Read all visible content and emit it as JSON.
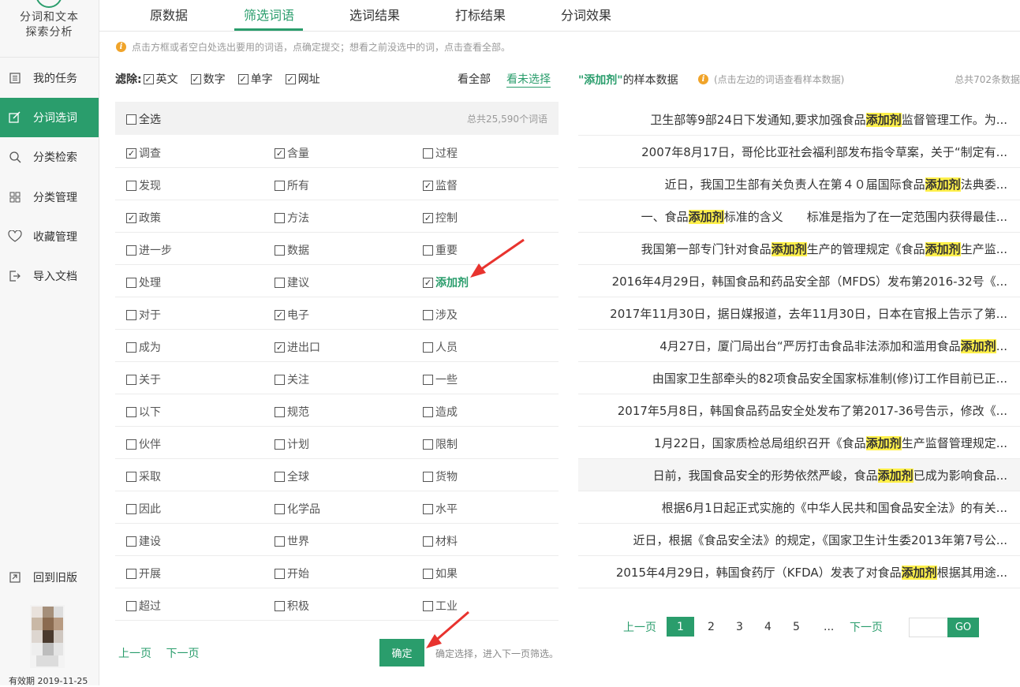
{
  "sidebar": {
    "app_title_line1": "分词和文本",
    "app_title_line2": "探索分析",
    "items": [
      {
        "label": "我的任务",
        "icon": "list-icon",
        "active": false
      },
      {
        "label": "分词选词",
        "icon": "edit-icon",
        "active": true
      },
      {
        "label": "分类检索",
        "icon": "search-icon",
        "active": false
      },
      {
        "label": "分类管理",
        "icon": "grid-icon",
        "active": false
      },
      {
        "label": "收藏管理",
        "icon": "heart-icon",
        "active": false
      },
      {
        "label": "导入文档",
        "icon": "import-icon",
        "active": false
      }
    ],
    "back_old": "回到旧版",
    "expire": "有效期 2019-11-25"
  },
  "tabs": [
    "原数据",
    "筛选词语",
    "选词结果",
    "打标结果",
    "分词效果"
  ],
  "active_tab": "筛选词语",
  "tip": "点击方框或者空白处选出要用的词语，点确定提交；想看之前没选中的词，点击查看全部。",
  "filter": {
    "label": "滤除:",
    "options": [
      {
        "label": "英文",
        "checked": true
      },
      {
        "label": "数字",
        "checked": true
      },
      {
        "label": "单字",
        "checked": true
      },
      {
        "label": "网址",
        "checked": true
      }
    ],
    "view_all": "看全部",
    "view_unselected": "看未选择"
  },
  "words": {
    "select_all": "全选",
    "total": "总共25,590个词语",
    "rows": [
      [
        {
          "w": "调查",
          "c": true
        },
        {
          "w": "含量",
          "c": true
        },
        {
          "w": "过程",
          "c": false
        }
      ],
      [
        {
          "w": "发现",
          "c": false
        },
        {
          "w": "所有",
          "c": false
        },
        {
          "w": "监督",
          "c": true
        }
      ],
      [
        {
          "w": "政策",
          "c": true
        },
        {
          "w": "方法",
          "c": false
        },
        {
          "w": "控制",
          "c": true
        }
      ],
      [
        {
          "w": "进一步",
          "c": false
        },
        {
          "w": "数据",
          "c": false
        },
        {
          "w": "重要",
          "c": false
        }
      ],
      [
        {
          "w": "处理",
          "c": false
        },
        {
          "w": "建议",
          "c": false
        },
        {
          "w": "添加剂",
          "c": true
        }
      ],
      [
        {
          "w": "对于",
          "c": false
        },
        {
          "w": "电子",
          "c": true
        },
        {
          "w": "涉及",
          "c": false
        }
      ],
      [
        {
          "w": "成为",
          "c": false
        },
        {
          "w": "进出口",
          "c": true
        },
        {
          "w": "人员",
          "c": false
        }
      ],
      [
        {
          "w": "关于",
          "c": false
        },
        {
          "w": "关注",
          "c": false
        },
        {
          "w": "一些",
          "c": false
        }
      ],
      [
        {
          "w": "以下",
          "c": false
        },
        {
          "w": "规范",
          "c": false
        },
        {
          "w": "造成",
          "c": false
        }
      ],
      [
        {
          "w": "伙伴",
          "c": false
        },
        {
          "w": "计划",
          "c": false
        },
        {
          "w": "限制",
          "c": false
        }
      ],
      [
        {
          "w": "采取",
          "c": false
        },
        {
          "w": "全球",
          "c": false
        },
        {
          "w": "货物",
          "c": false
        }
      ],
      [
        {
          "w": "因此",
          "c": false
        },
        {
          "w": "化学品",
          "c": false
        },
        {
          "w": "水平",
          "c": false
        }
      ],
      [
        {
          "w": "建设",
          "c": false
        },
        {
          "w": "世界",
          "c": false
        },
        {
          "w": "材料",
          "c": false
        }
      ],
      [
        {
          "w": "开展",
          "c": false
        },
        {
          "w": "开始",
          "c": false
        },
        {
          "w": "如果",
          "c": false
        }
      ],
      [
        {
          "w": "超过",
          "c": false
        },
        {
          "w": "积极",
          "c": false
        },
        {
          "w": "工业",
          "c": false
        }
      ]
    ],
    "prev": "上一页",
    "next": "下一页",
    "confirm": "确定",
    "confirm_tip": "确定选择，进入下一页筛选。"
  },
  "sample": {
    "keyword": "添加剂",
    "title_suffix": "的样本数据",
    "tip": "(点击左边的词语查看样本数据)",
    "total": "总共702条数据",
    "rows": [
      [
        [
          "卫生部等9部24日下发通知,要求加强食品",
          false
        ],
        [
          "添加剂",
          true
        ],
        [
          "监督管理工作。为...",
          false
        ]
      ],
      [
        [
          "2007年8月17日，哥伦比亚社会福利部发布指令草案，关于“制定有...",
          false
        ]
      ],
      [
        [
          "近日，我国卫生部有关负责人在第４０届国际食品",
          false
        ],
        [
          "添加剂",
          true
        ],
        [
          "法典委...",
          false
        ]
      ],
      [
        [
          "一、食品",
          false
        ],
        [
          "添加剂",
          true
        ],
        [
          "标准的含义　　标准是指为了在一定范围内获得最佳...",
          false
        ]
      ],
      [
        [
          "我国第一部专门针对食品",
          false
        ],
        [
          "添加剂",
          true
        ],
        [
          "生产的管理规定《食品",
          false
        ],
        [
          "添加剂",
          true
        ],
        [
          "生产监...",
          false
        ]
      ],
      [
        [
          "2016年4月29日，韩国食品和药品安全部（MFDS）发布第2016-32号《...",
          false
        ]
      ],
      [
        [
          "2017年11月30日，据日媒报道，去年11月30日，日本在官报上告示了第...",
          false
        ]
      ],
      [
        [
          "4月27日，厦门局出台“严厉打击食品非法添加和滥用食品",
          false
        ],
        [
          "添加剂",
          true
        ],
        [
          "...",
          false
        ]
      ],
      [
        [
          "由国家卫生部牵头的82项食品安全国家标准制(修)订工作目前已正...",
          false
        ]
      ],
      [
        [
          "2017年5月8日，韩国食品药品安全处发布了第2017-36号告示，修改《...",
          false
        ]
      ],
      [
        [
          "1月22日，国家质检总局组织召开《食品",
          false
        ],
        [
          "添加剂",
          true
        ],
        [
          "生产监督管理规定...",
          false
        ]
      ],
      [
        [
          "日前，我国食品安全的形势依然严峻，食品",
          false
        ],
        [
          "添加剂",
          true
        ],
        [
          "已成为影响食品...",
          false
        ]
      ],
      [
        [
          "根据6月1日起正式实施的《中华人民共和国食品安全法》的有关...",
          false
        ]
      ],
      [
        [
          "近日，根据《食品安全法》的规定，《国家卫生计生委2013年第7号公...",
          false
        ]
      ],
      [
        [
          "2015年4月29日，韩国食药厅（KFDA）发表了对食品",
          false
        ],
        [
          "添加剂",
          true
        ],
        [
          "根据其用途...",
          false
        ]
      ]
    ],
    "pager": {
      "prev": "上一页",
      "pages": [
        "1",
        "2",
        "3",
        "4",
        "5",
        "..."
      ],
      "next": "下一页",
      "go": "GO"
    }
  },
  "colors": {
    "accent": "#2a9d6c",
    "highlight": "#fff04a",
    "annotation_arrow": "#e8332e"
  }
}
